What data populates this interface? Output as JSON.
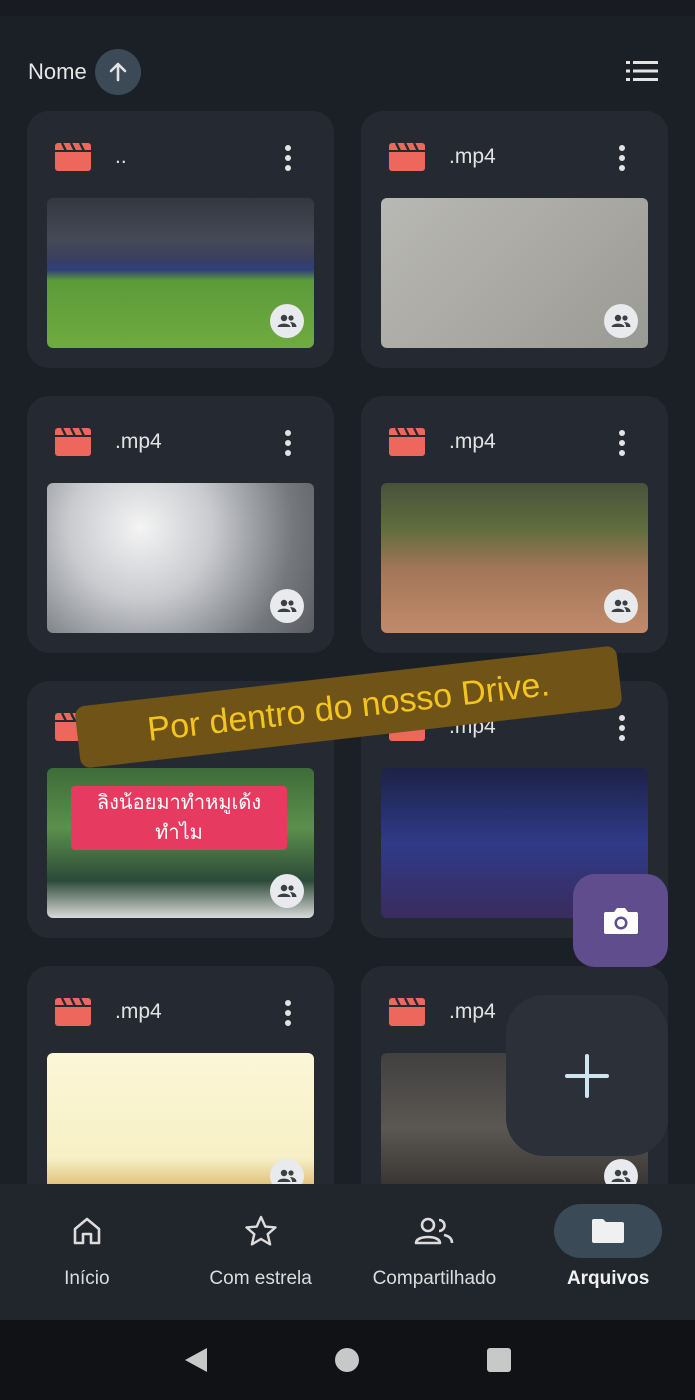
{
  "header": {
    "sort_label": "Nome",
    "sort_icon": "arrow-up-icon",
    "view_icon": "list-view-icon"
  },
  "files": [
    {
      "name": "..",
      "icon": "video-file-icon"
    },
    {
      "name": ".mp4",
      "icon": "video-file-icon"
    },
    {
      "name": ".mp4",
      "icon": "video-file-icon"
    },
    {
      "name": ".mp4",
      "icon": "video-file-icon"
    },
    {
      "name": "",
      "icon": "video-file-icon",
      "caption": "ลิงน้อยมาทำหมูเด้ง ทำไม"
    },
    {
      "name": ".mp4",
      "icon": "video-file-icon"
    },
    {
      "name": ".mp4",
      "icon": "video-file-icon"
    },
    {
      "name": ".mp4",
      "icon": "video-file-icon"
    }
  ],
  "overlay": {
    "text": "Por dentro do nosso Drive."
  },
  "fab": {
    "camera_icon": "camera-icon",
    "add_icon": "plus-icon"
  },
  "bottom_nav": {
    "items": [
      {
        "label": "Início",
        "icon": "home-icon",
        "active": false
      },
      {
        "label": "Com estrela",
        "icon": "star-icon",
        "active": false
      },
      {
        "label": "Compartilhado",
        "icon": "people-icon",
        "active": false
      },
      {
        "label": "Arquivos",
        "icon": "folder-icon",
        "active": true
      }
    ]
  },
  "system_nav": {
    "icons": [
      "back-icon",
      "home-circle-icon",
      "recents-icon"
    ]
  },
  "colors": {
    "background": "#1b1f26",
    "card": "#252a32",
    "file_icon_red": "#ee675c",
    "fab_camera": "#5f4d8e",
    "banner_bg": "#6f5317",
    "banner_text": "#f4c61d"
  }
}
